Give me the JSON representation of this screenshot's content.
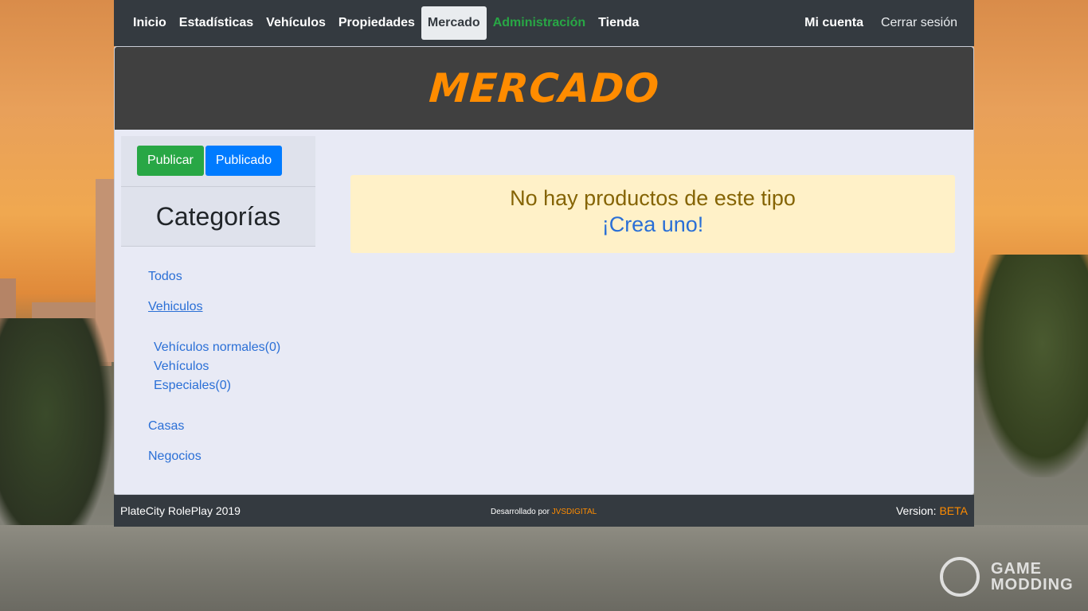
{
  "nav": {
    "items": [
      {
        "label": "Inicio"
      },
      {
        "label": "Estadísticas"
      },
      {
        "label": "Vehículos"
      },
      {
        "label": "Propiedades"
      },
      {
        "label": "Mercado",
        "active": true
      },
      {
        "label": "Administración",
        "color": "#28a745"
      },
      {
        "label": "Tienda"
      }
    ],
    "account": "Mi cuenta",
    "logout": "Cerrar sesión"
  },
  "header": {
    "title": "MERCADO",
    "title_color": "#ff8c00"
  },
  "sidebar": {
    "publish_button": "Publicar",
    "published_button": "Publicado",
    "categories_title": "Categorías",
    "categories": [
      {
        "label": "Todos"
      },
      {
        "label": "Vehiculos"
      },
      {
        "label": "Casas"
      },
      {
        "label": "Negocios"
      }
    ],
    "subcategories": [
      {
        "label": "Vehículos normales(0)"
      },
      {
        "label": "Vehículos"
      },
      {
        "label": "Especiales(0)"
      }
    ]
  },
  "main": {
    "empty_message": "No hay productos de este tipo",
    "create_link": "¡Crea uno!"
  },
  "footer": {
    "left": "PlateCity RolePlay 2019",
    "dev_prefix": "Desarrollado por",
    "dev_brand": "JVSDIGITAL",
    "version_label": "Version:",
    "version_value": "BETA"
  },
  "watermark": {
    "line1": "GAME",
    "line2": "MODDING"
  },
  "colors": {
    "navbar": "#343a40",
    "panel": "#e8eaf5",
    "alert_bg": "#fff1c8",
    "link": "#2a6fd6",
    "green": "#28a745",
    "blue": "#007bff"
  }
}
